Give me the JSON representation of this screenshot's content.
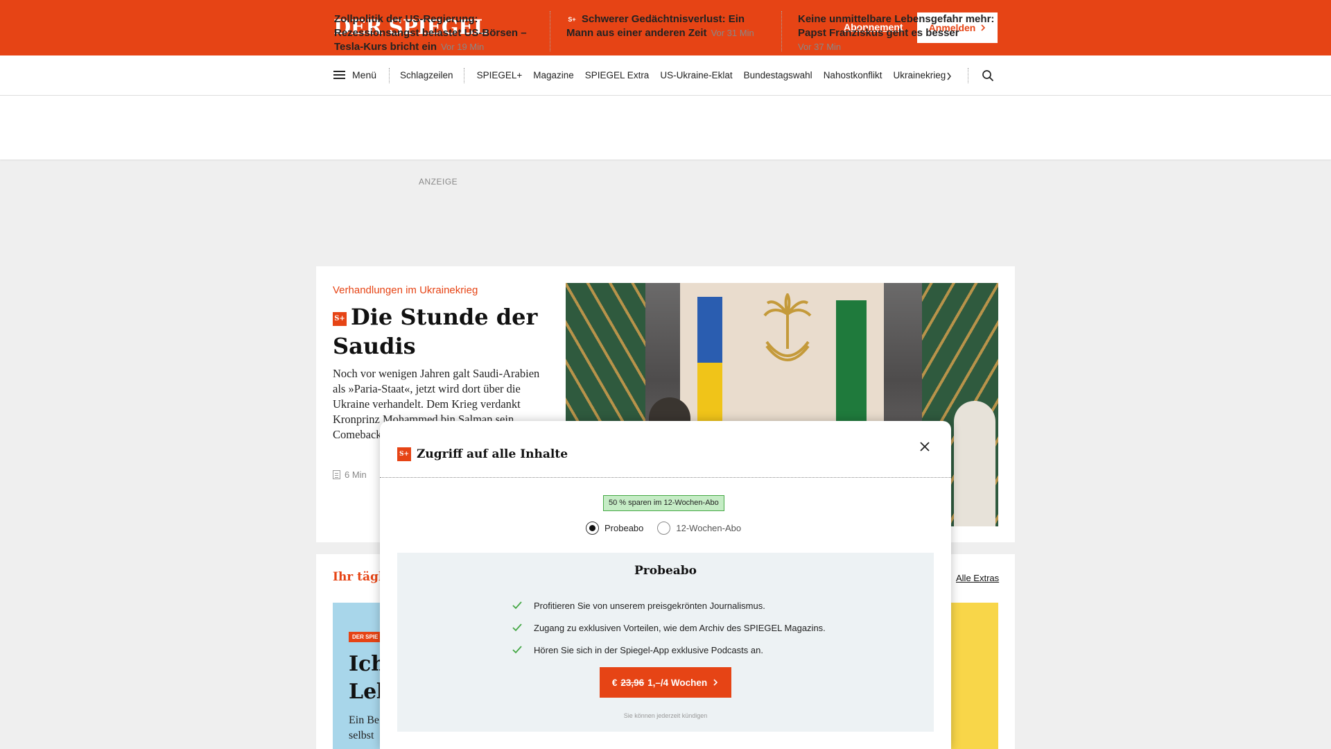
{
  "header": {
    "logo": "DER SPIEGEL",
    "abo_link": "Abonnement",
    "login_label": "Anmelden",
    "accent_color": "#e64415"
  },
  "nav": {
    "menu_label": "Menü",
    "items": [
      "Schlagzeilen",
      "SPIEGEL+",
      "Magazine",
      "SPIEGEL Extra",
      "US-Ukraine-Eklat",
      "Bundestagswahl",
      "Nahostkonflikt",
      "Ukrainekrieg"
    ]
  },
  "ticker": [
    {
      "title": "Zollpolitik der US-Regierung: Rezessionsangst belastet US-Börsen – Tesla-Kurs bricht ein",
      "time": "Vor 19 Min",
      "plus": false
    },
    {
      "title": "Schwerer Gedächtnisverlust: Ein Mann aus einer anderen Zeit",
      "time": "Vor 31 Min",
      "plus": true
    },
    {
      "title": "Keine unmittelbare Lebensgefahr mehr: Papst Franziskus geht es besser",
      "time": "Vor 37 Min",
      "plus": false
    }
  ],
  "ad_label": "ANZEIGE",
  "hero": {
    "kicker": "Verhandlungen im Ukrainekrieg",
    "headline": "Die Stunde der Saudis",
    "teaser": "Noch vor wenigen Jahren galt Saudi-Arabien als »Paria-Staat«, jetzt wird dort über die Ukraine verhandelt. Dem Krieg verdankt Kronprinz Mohammed bin Salman sein Comeback … Gespräche",
    "read_time": "6 Min"
  },
  "extras": {
    "title": "Ihr täglic",
    "all_link": "Alle Extras",
    "badge": "DER SPIE",
    "big_text": "Ich Leb",
    "small_text": "Ein Be selbst"
  },
  "modal": {
    "title": "Zugriff auf alle Inhalte",
    "save_badge": "50 % sparen im 12-Wochen-Abo",
    "options": [
      "Probeabo",
      "12-Wochen-Abo"
    ],
    "selected_option": "Probeabo",
    "offer_title": "Probeabo",
    "benefits": [
      "Profitieren Sie von unserem preisgekrönten Journalismus.",
      "Zugang zu exklusiven Vorteilen, wie dem Archiv des SPIEGEL Magazins.",
      "Hören Sie sich in der Spiegel-App exklusive Podcasts an."
    ],
    "cta_currency": "€",
    "cta_old_price": "23,96",
    "cta_new_price": "1,–/4 Wochen",
    "cancel_note": "Sie können jederzeit kündigen"
  }
}
